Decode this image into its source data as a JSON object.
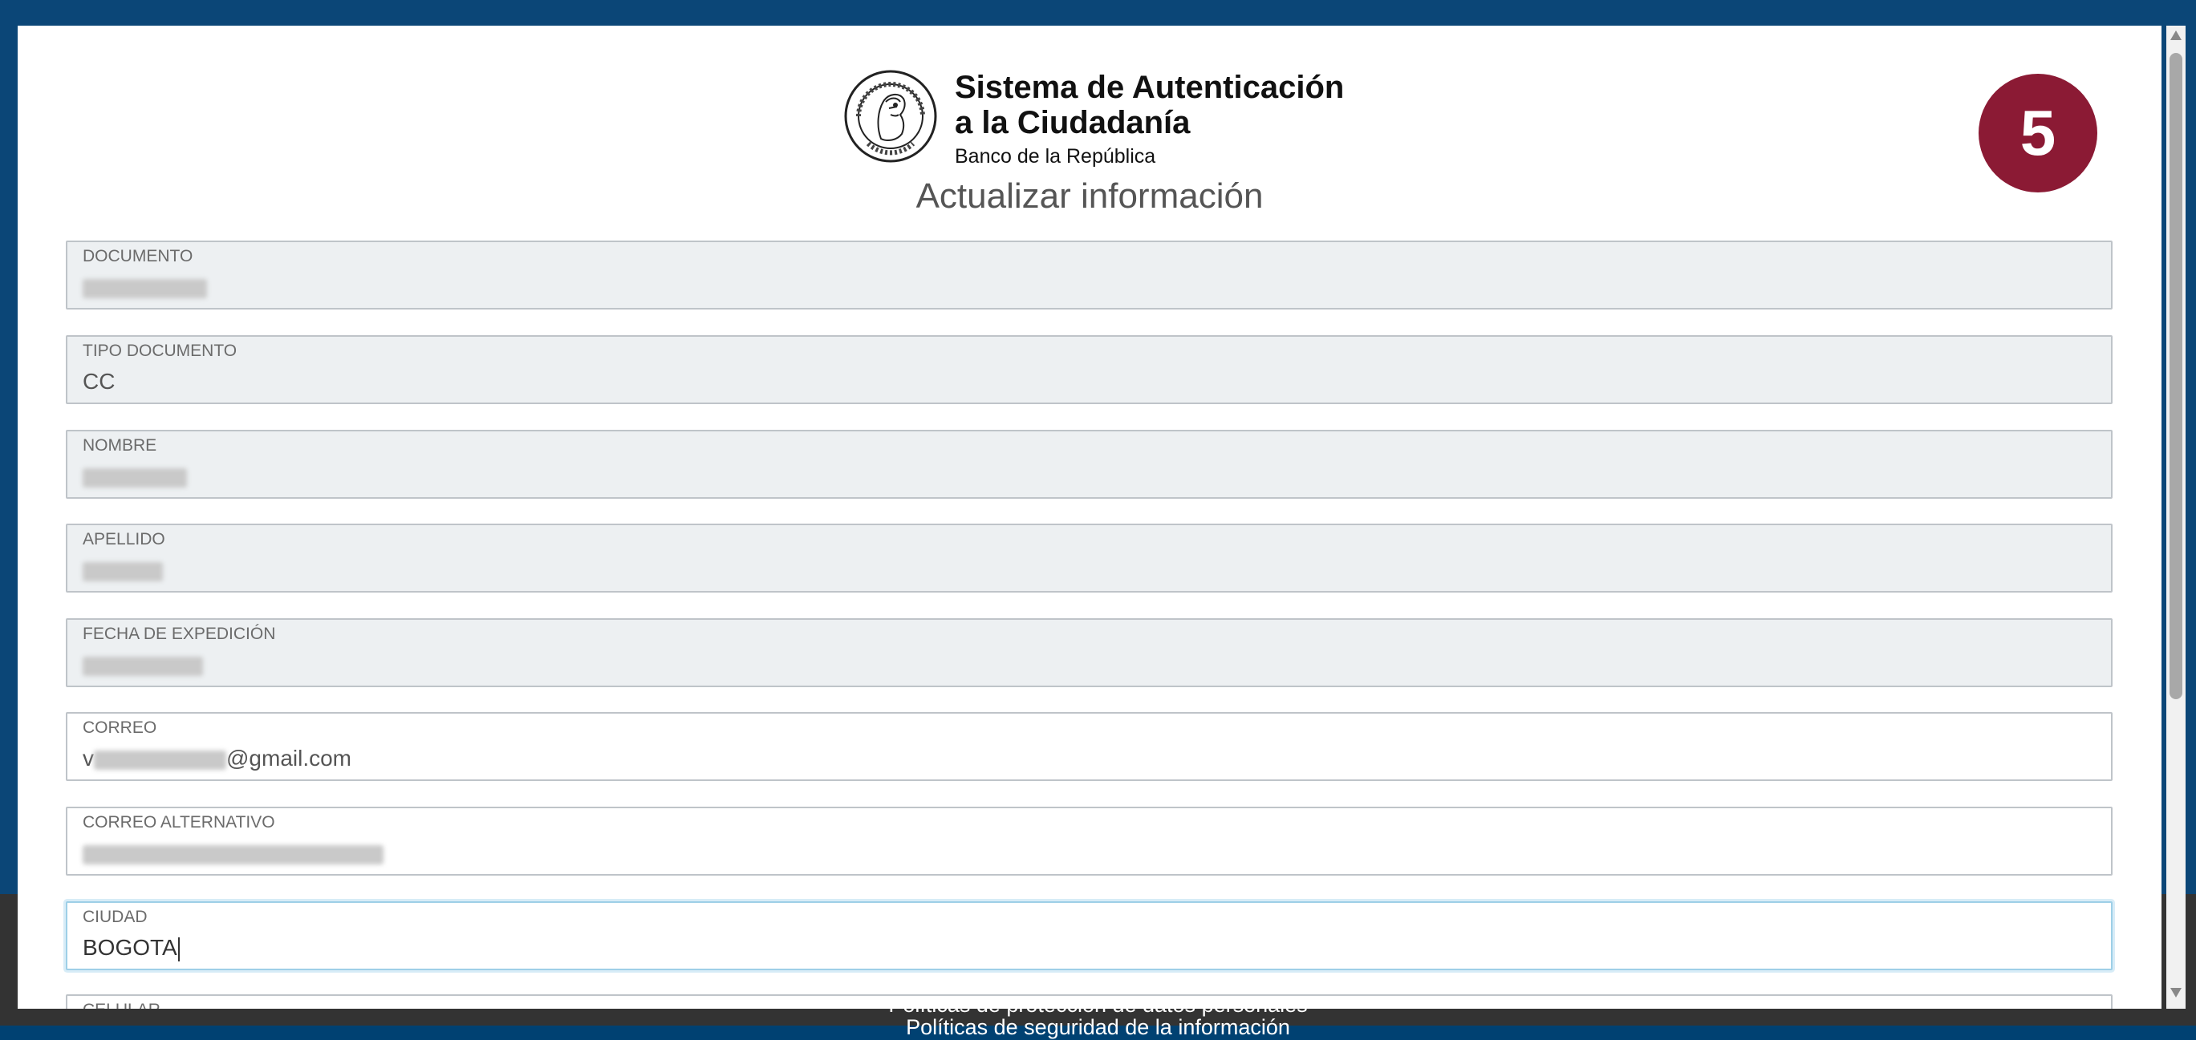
{
  "header": {
    "title_line1": "Sistema de Autenticación",
    "title_line2": "a la Ciudadanía",
    "subtitle": "Banco de la República",
    "seal_top": "BANCO DE LA REPUBLICA",
    "seal_bottom": "COLOMBIA",
    "logo_icon": "banco-seal-icon"
  },
  "page_title": "Actualizar información",
  "step_badge": "5",
  "fields": {
    "documento": {
      "label": "DOCUMENTO",
      "value": ""
    },
    "tipo_documento": {
      "label": "TIPO DOCUMENTO",
      "value": "CC"
    },
    "nombre": {
      "label": "NOMBRE",
      "value": ""
    },
    "apellido": {
      "label": "APELLIDO",
      "value": ""
    },
    "fecha_expedicion": {
      "label": "FECHA DE EXPEDICIÓN",
      "value": ""
    },
    "correo": {
      "label": "CORREO",
      "value_prefix": "v",
      "value_suffix": "@gmail.com"
    },
    "correo_alternativo": {
      "label": "CORREO ALTERNATIVO",
      "value": ""
    },
    "ciudad": {
      "label": "CIUDAD",
      "value": "BOGOTA"
    },
    "celular": {
      "label": "CELULAR"
    }
  },
  "footer": {
    "link1": "Políticas de protección de datos personales",
    "link2": "Políticas de seguridad de la información"
  },
  "colors": {
    "brand_blue": "#0b4677",
    "badge": "#8b1a34",
    "footer_bg": "#333333"
  }
}
